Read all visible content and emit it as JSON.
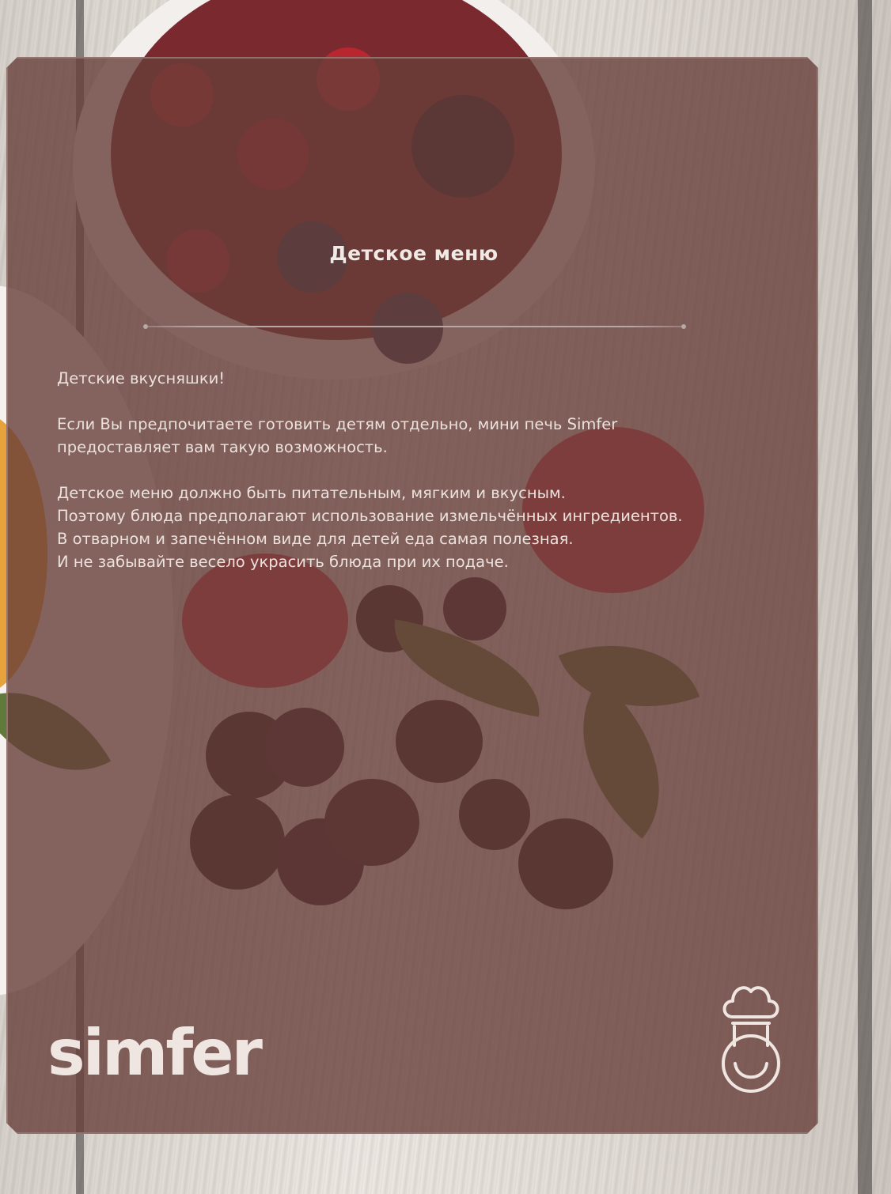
{
  "title": "Детское меню",
  "intro": "Детские вкусняшки!",
  "paragraph1": [
    "Если Вы предпочитаете готовить детям отдельно, мини печь Simfer",
    "предоставляет вам такую возможность."
  ],
  "paragraph2": [
    "Детское меню должно быть питательным, мягким и вкусным.",
    "Поэтому блюда предполагают использование измельчённых ингредиентов.",
    "В  отварном и запечённом виде для детей еда самая полезная.",
    "И не забывайте весело украсить блюда при их подаче."
  ],
  "brand": "simfer",
  "icons": {
    "chef": "chef-hat-icon"
  },
  "colors": {
    "overlay": "#683e3a",
    "text": "#ece2dd"
  }
}
